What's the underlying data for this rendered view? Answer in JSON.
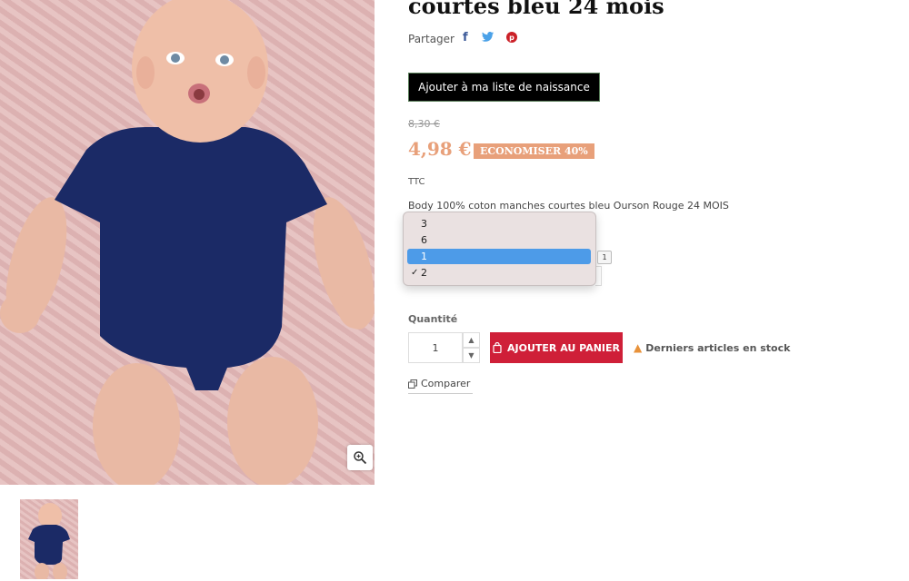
{
  "product": {
    "title": "courtes bleu 24 mois",
    "share_label": "Partager",
    "share_icons": {
      "facebook": "f",
      "twitter": "t",
      "pinterest": "p"
    },
    "birth_list_button": "Ajouter à ma liste de naissance",
    "old_price": "8,30 €",
    "price": "4,98 €",
    "discount": "ECONOMISER 40%",
    "tax_label": "TTC",
    "description": "Body 100% coton manches courtes bleu Ourson Rouge 24 MOIS"
  },
  "dropdown": {
    "options": [
      "3",
      "6",
      "1",
      "2"
    ],
    "highlighted": "1",
    "selected": "2",
    "side_value": "1"
  },
  "quantity": {
    "label": "Quantité",
    "value": "1"
  },
  "cart": {
    "add_button": "AJOUTER AU PANIER",
    "stock_message": "Derniers articles en stock"
  },
  "compare_label": "Comparer",
  "colors": {
    "price_accent": "#e8a07a",
    "cart_button": "#cf1f38",
    "dropdown_highlight": "#4d9be8",
    "warning": "#e8923a"
  }
}
